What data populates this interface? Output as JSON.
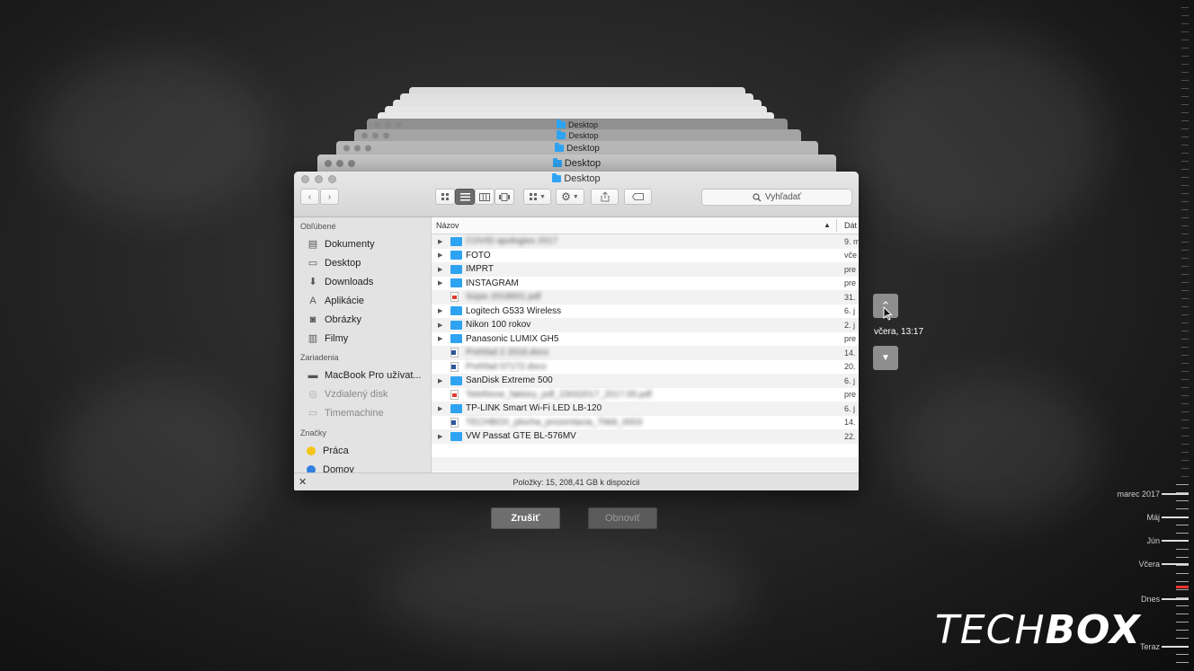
{
  "window": {
    "title": "Desktop",
    "back_titles": [
      "Desktop",
      "Desktop",
      "Desktop",
      "Desktop"
    ]
  },
  "toolbar": {
    "search_placeholder": "Vyhľadať"
  },
  "sidebar": {
    "sections": [
      {
        "header": "Obľúbené",
        "items": [
          {
            "label": "Dokumenty",
            "icon": "document-icon"
          },
          {
            "label": "Desktop",
            "icon": "desktop-icon"
          },
          {
            "label": "Downloads",
            "icon": "download-icon"
          },
          {
            "label": "Aplikácie",
            "icon": "applications-icon"
          },
          {
            "label": "Obrázky",
            "icon": "camera-icon"
          },
          {
            "label": "Filmy",
            "icon": "film-icon"
          }
        ]
      },
      {
        "header": "Zariadenia",
        "items": [
          {
            "label": "MacBook Pro užívat...",
            "icon": "laptop-icon"
          },
          {
            "label": "Vzdialený disk",
            "icon": "disc-icon"
          },
          {
            "label": "Timemachine",
            "icon": "drive-icon"
          }
        ]
      },
      {
        "header": "Značky",
        "items": [
          {
            "label": "Práca",
            "color": "#f5c518"
          },
          {
            "label": "Domov",
            "color": "#2f7fe0"
          }
        ]
      }
    ]
  },
  "columns": {
    "name": "Názov",
    "date": "Dát"
  },
  "files": [
    {
      "name": "COVID apologies 2017",
      "type": "folder",
      "expandable": true,
      "blurred": true,
      "date": "9. m"
    },
    {
      "name": "FOTO",
      "type": "folder",
      "expandable": true,
      "blurred": false,
      "date": "vče"
    },
    {
      "name": "IMPRT",
      "type": "folder",
      "expandable": true,
      "blurred": false,
      "date": "pre"
    },
    {
      "name": "INSTAGRAM",
      "type": "folder",
      "expandable": true,
      "blurred": false,
      "date": "pre"
    },
    {
      "name": "Súpis 2018001.pdf",
      "type": "pdf",
      "expandable": false,
      "blurred": true,
      "date": "31."
    },
    {
      "name": "Logitech G533 Wireless",
      "type": "folder",
      "expandable": true,
      "blurred": false,
      "date": "6. j"
    },
    {
      "name": "Nikon 100 rokov",
      "type": "folder",
      "expandable": true,
      "blurred": false,
      "date": "2. j"
    },
    {
      "name": "Panasonic LUMIX GH5",
      "type": "folder",
      "expandable": true,
      "blurred": false,
      "date": "pre"
    },
    {
      "name": "Prehľad 2 2016.docx",
      "type": "doc",
      "expandable": false,
      "blurred": true,
      "date": "14."
    },
    {
      "name": "Prehľad 07172.docx",
      "type": "doc",
      "expandable": false,
      "blurred": true,
      "date": "20."
    },
    {
      "name": "SanDisk Extreme 500",
      "type": "folder",
      "expandable": true,
      "blurred": false,
      "date": "6. j"
    },
    {
      "name": "Telefónne_faktúry_pdf_23032017_2017.05.pdf",
      "type": "pdf",
      "expandable": false,
      "blurred": true,
      "date": "pre"
    },
    {
      "name": "TP-LINK Smart Wi-Fi LED LB-120",
      "type": "folder",
      "expandable": true,
      "blurred": false,
      "date": "6. j"
    },
    {
      "name": "TECHBOX_plocha_prezentacia_TMdi_0003",
      "type": "doc",
      "expandable": false,
      "blurred": true,
      "date": "14."
    },
    {
      "name": "VW Passat GTE BL-576MV",
      "type": "folder",
      "expandable": true,
      "blurred": false,
      "date": "22."
    }
  ],
  "status": "Položky: 15, 208,41 GB k dispozícii",
  "actions": {
    "cancel": "Zrušiť",
    "restore": "Obnoviť"
  },
  "timemachine": {
    "current_time": "včera, 13:17",
    "timeline_labels": [
      "marec 2017",
      "Máj",
      "Jún",
      "Včera",
      "Dnes",
      "Teraz"
    ]
  },
  "logo": {
    "part1": "TECH",
    "part2": "BOX"
  }
}
